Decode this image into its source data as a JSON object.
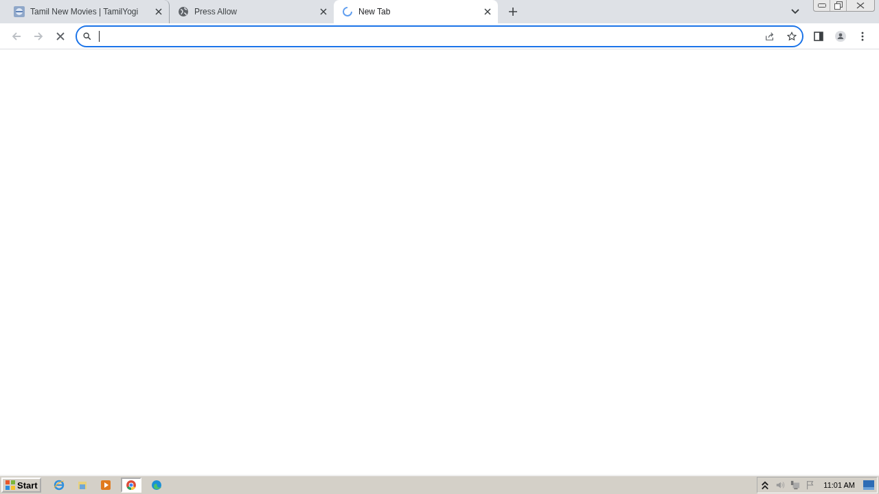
{
  "tabs": [
    {
      "title": "Tamil New Movies | TamilYogi",
      "selected": false,
      "kind": "site"
    },
    {
      "title": "Press Allow",
      "selected": false,
      "kind": "globe"
    },
    {
      "title": "New Tab",
      "selected": true,
      "kind": "loading"
    }
  ],
  "taskbar": {
    "start": "Start",
    "apps": [
      {
        "kind": "ie",
        "selected": false
      },
      {
        "kind": "folder",
        "selected": false
      },
      {
        "kind": "media",
        "selected": false
      },
      {
        "kind": "chrome",
        "selected": true
      },
      {
        "kind": "edge",
        "selected": false
      }
    ],
    "clock": "11:01 AM"
  }
}
